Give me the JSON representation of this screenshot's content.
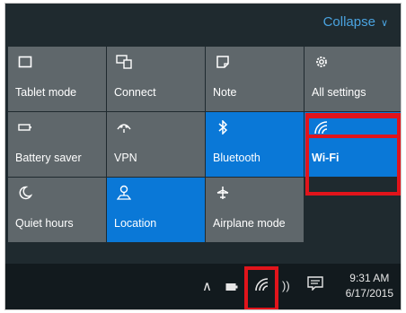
{
  "header": {
    "collapse_label": "Collapse"
  },
  "tiles": [
    {
      "label": "Tablet mode",
      "icon": "tablet-mode-icon",
      "active": false
    },
    {
      "label": "Connect",
      "icon": "connect-icon",
      "active": false
    },
    {
      "label": "Note",
      "icon": "note-icon",
      "active": false
    },
    {
      "label": "All settings",
      "icon": "gear-icon",
      "active": false
    },
    {
      "label": "Battery saver",
      "icon": "battery-icon",
      "active": false
    },
    {
      "label": "VPN",
      "icon": "vpn-icon",
      "active": false
    },
    {
      "label": "Bluetooth",
      "icon": "bluetooth-icon",
      "active": true
    },
    {
      "label": "Wi-Fi",
      "icon": "wifi-icon",
      "active": true
    },
    {
      "label": "Quiet hours",
      "icon": "moon-icon",
      "active": false
    },
    {
      "label": "Location",
      "icon": "location-icon",
      "active": true
    },
    {
      "label": "Airplane mode",
      "icon": "airplane-icon",
      "active": false
    }
  ],
  "taskbar": {
    "time": "9:31 AM",
    "date": "6/17/2015"
  },
  "colors": {
    "accent": "#0a78d7",
    "tile": "#5f676b",
    "highlight": "#e1141b",
    "panel": "#1f2a2f"
  }
}
